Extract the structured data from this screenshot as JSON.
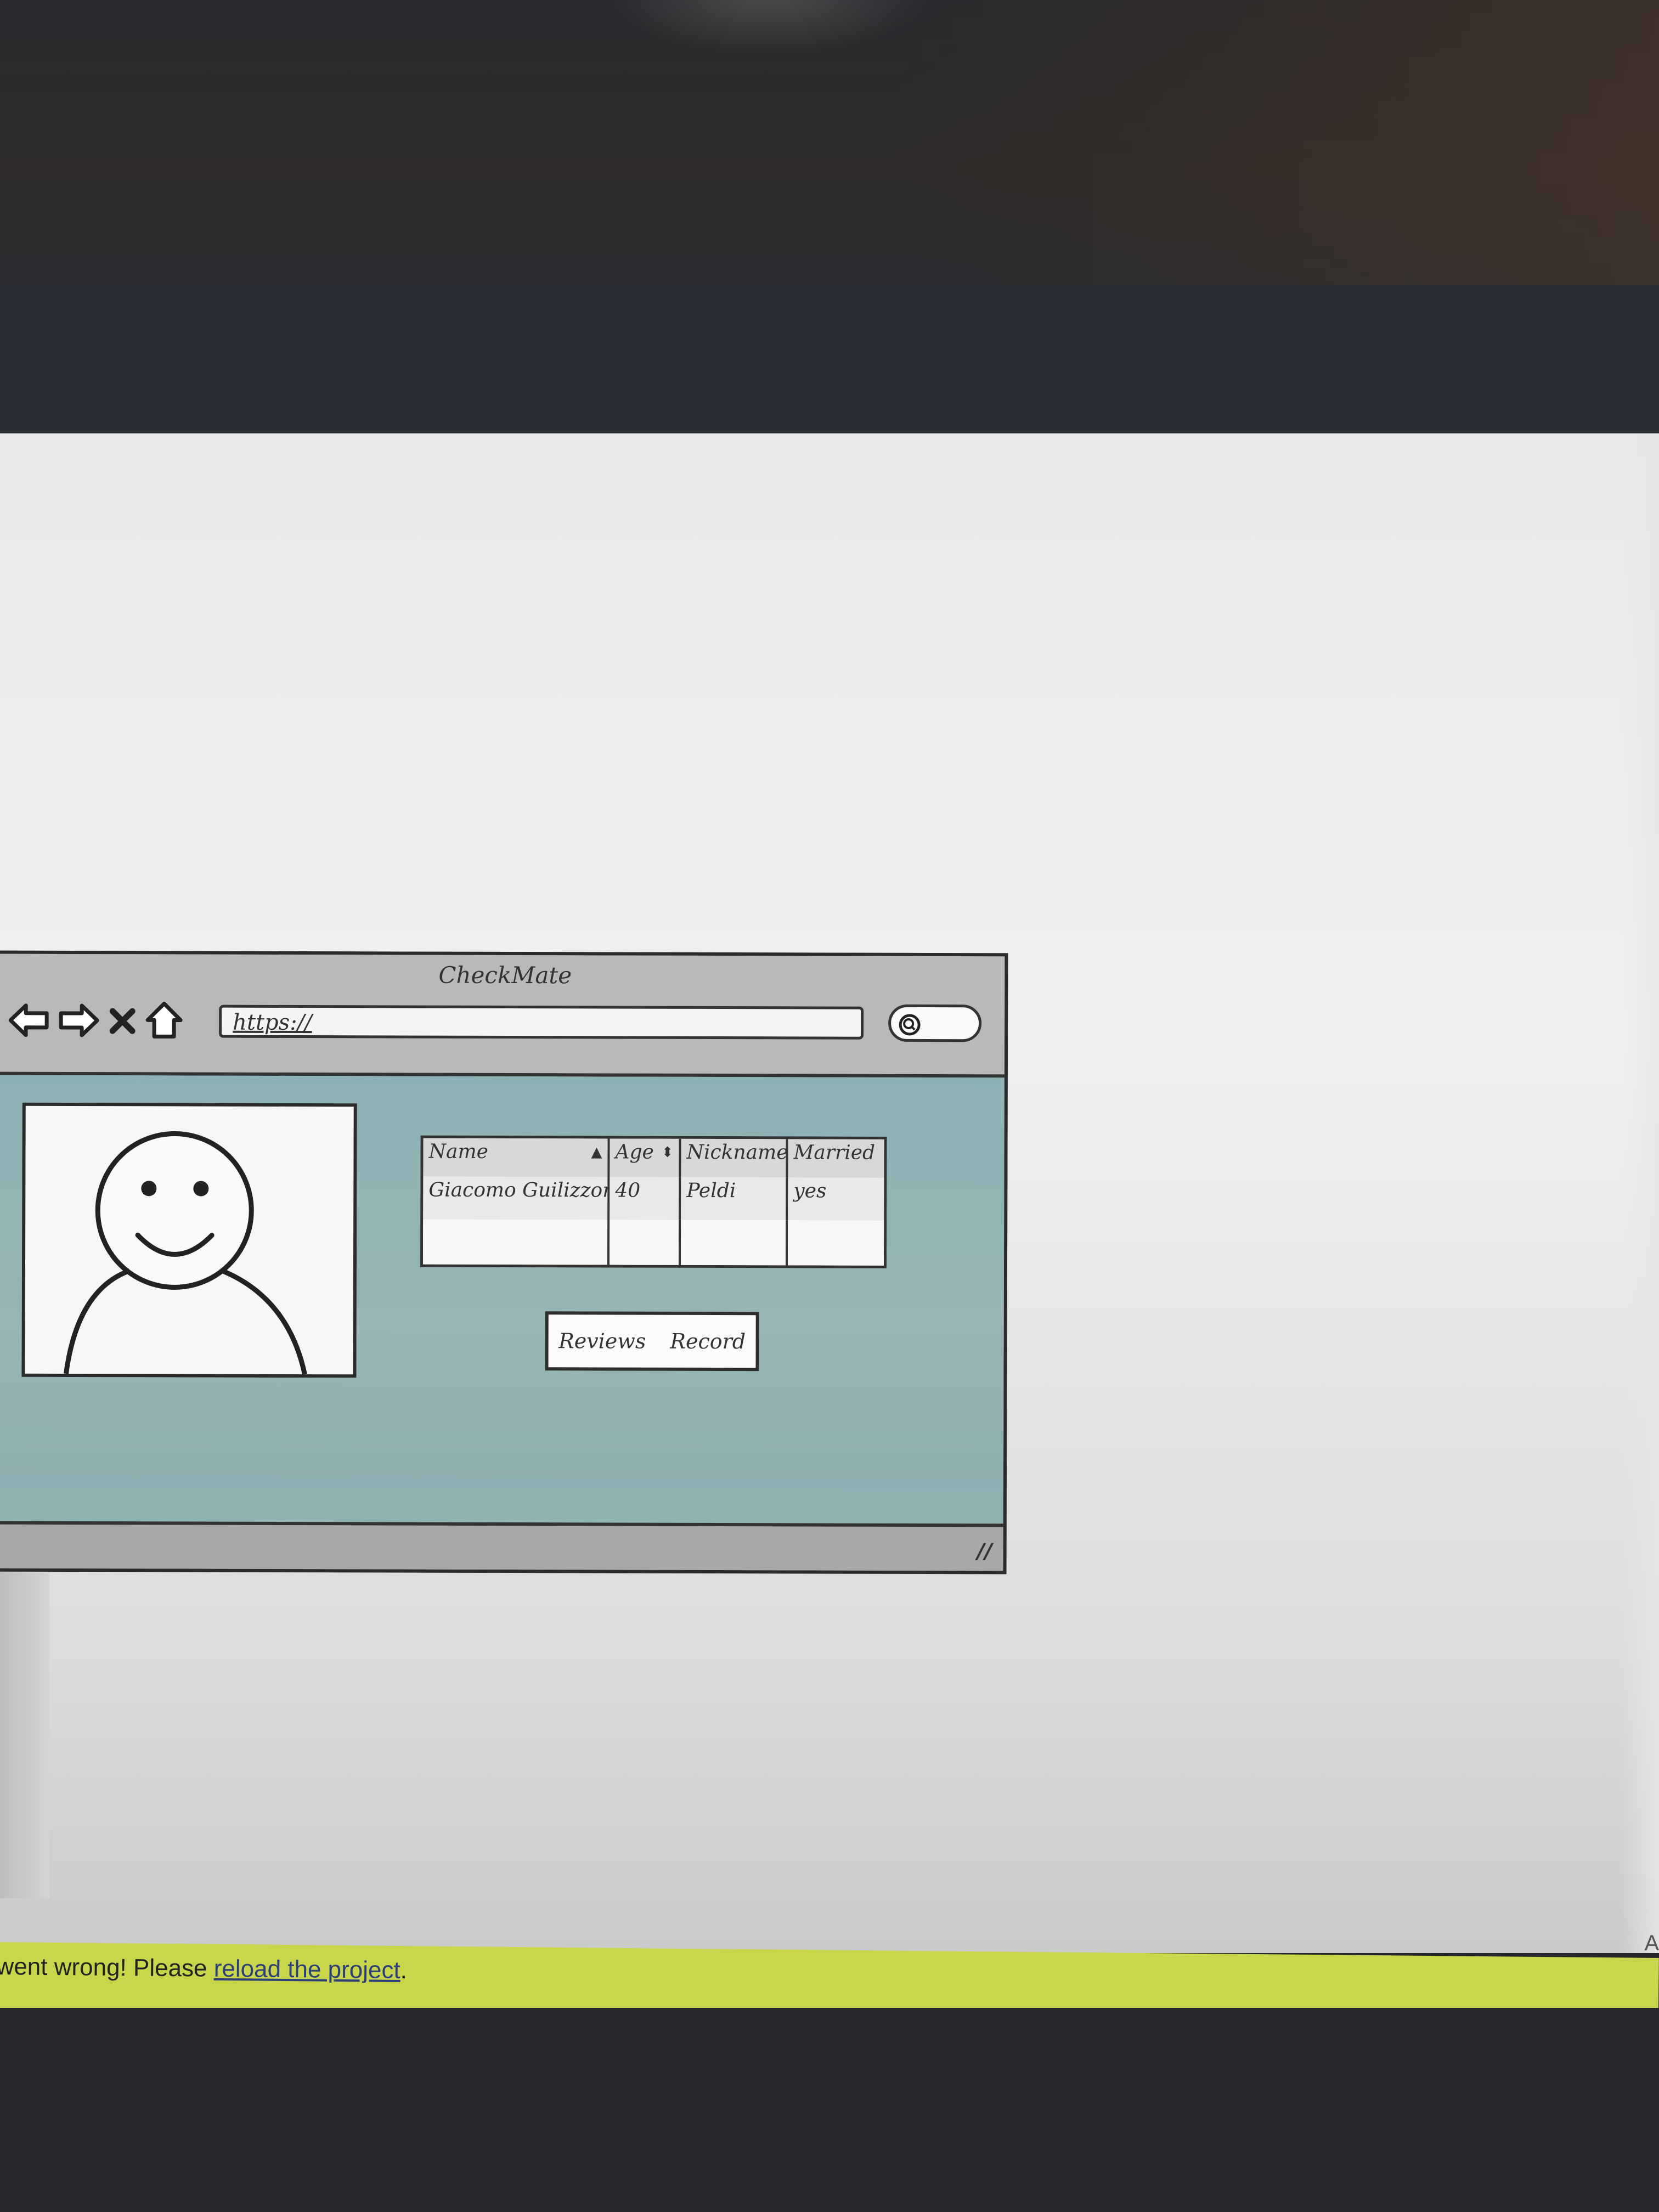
{
  "mockup": {
    "title": "CheckMate",
    "url": "https://",
    "table": {
      "headers": [
        "Name",
        "Age",
        "Nickname",
        "Married"
      ],
      "rows": [
        [
          "Giacomo Guilizzoni",
          "40",
          "Peldi",
          "yes"
        ]
      ]
    },
    "buttons": [
      "Reviews",
      "Record"
    ]
  },
  "error_bar": {
    "message_start": "went wrong! Please ",
    "link": "reload the project",
    "message_end": "."
  },
  "corner_char": "A"
}
